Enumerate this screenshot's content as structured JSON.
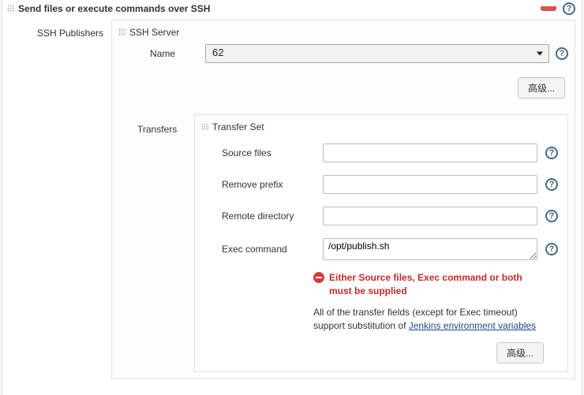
{
  "header": {
    "title": "Send files or execute commands over SSH"
  },
  "left": {
    "ssh_publishers": "SSH Publishers"
  },
  "ssh_server": {
    "panel_title": "SSH Server",
    "name_label": "Name",
    "name_value": "62",
    "advanced_button": "高级..."
  },
  "transfers": {
    "label": "Transfers",
    "panel_title": "Transfer Set",
    "fields": {
      "source_files_label": "Source files",
      "source_files_value": "",
      "remove_prefix_label": "Remove prefix",
      "remove_prefix_value": "",
      "remote_directory_label": "Remote directory",
      "remote_directory_value": "",
      "exec_command_label": "Exec command",
      "exec_command_value": "/opt/publish.sh"
    },
    "error_text": "Either Source files, Exec command or both must be supplied",
    "help_text_pre": "All of the transfer fields (except for Exec timeout) support substitution of ",
    "help_link_text": "Jenkins environment variables",
    "advanced_button": "高级..."
  },
  "glyphs": {
    "help": "?"
  }
}
